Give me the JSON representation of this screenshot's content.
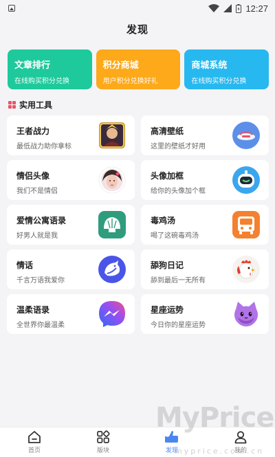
{
  "status_bar": {
    "time": "12:27"
  },
  "header": {
    "title": "发现"
  },
  "promos": [
    {
      "title": "文章排行",
      "subtitle": "在线购买积分兑换",
      "color": "#1ec99b"
    },
    {
      "title": "积分商城",
      "subtitle": "用户积分兑换好礼",
      "color": "#fda91a"
    },
    {
      "title": "商城系统",
      "subtitle": "在线购买积分兑换",
      "color": "#27b8ef"
    }
  ],
  "section": {
    "title": "实用工具"
  },
  "tools": [
    {
      "name": "王者战力",
      "desc": "最低战力助你拿标",
      "icon": "game-hero-avatar-icon"
    },
    {
      "name": "高清壁纸",
      "desc": "这里的壁纸才好用",
      "icon": "wallpaper-app-icon"
    },
    {
      "name": "情侣头像",
      "desc": "我们不是情侣",
      "icon": "couple-avatar-icon"
    },
    {
      "name": "头像加框",
      "desc": "给你的头像加个框",
      "icon": "avatar-frame-robot-icon"
    },
    {
      "name": "爱情公寓语录",
      "desc": "好男人就是我",
      "icon": "shell-app-icon"
    },
    {
      "name": "毒鸡汤",
      "desc": "喝了这碗毒鸡汤",
      "icon": "bus-app-icon"
    },
    {
      "name": "情话",
      "desc": "千言万语我爱你",
      "icon": "shark-app-icon"
    },
    {
      "name": "舔狗日记",
      "desc": "舔到最后一无所有",
      "icon": "rooster-icon"
    },
    {
      "name": "温柔语录",
      "desc": "全世界你最温柔",
      "icon": "messenger-icon"
    },
    {
      "name": "星座运势",
      "desc": "今日你的星座运势",
      "icon": "purple-cat-icon"
    }
  ],
  "nav": [
    {
      "label": "首页",
      "icon": "home-icon",
      "active": false
    },
    {
      "label": "版块",
      "icon": "grid-icon",
      "active": false
    },
    {
      "label": "发现",
      "icon": "discover-hand-icon",
      "active": true
    },
    {
      "label": "我的",
      "icon": "user-icon",
      "active": false
    }
  ],
  "watermark": {
    "main": "MyPrice",
    "sub": "myprice.com.cn"
  },
  "colors": {
    "accent": "#4a86f0",
    "section_icon": "#e8546a",
    "background": "#f4f4f6"
  }
}
